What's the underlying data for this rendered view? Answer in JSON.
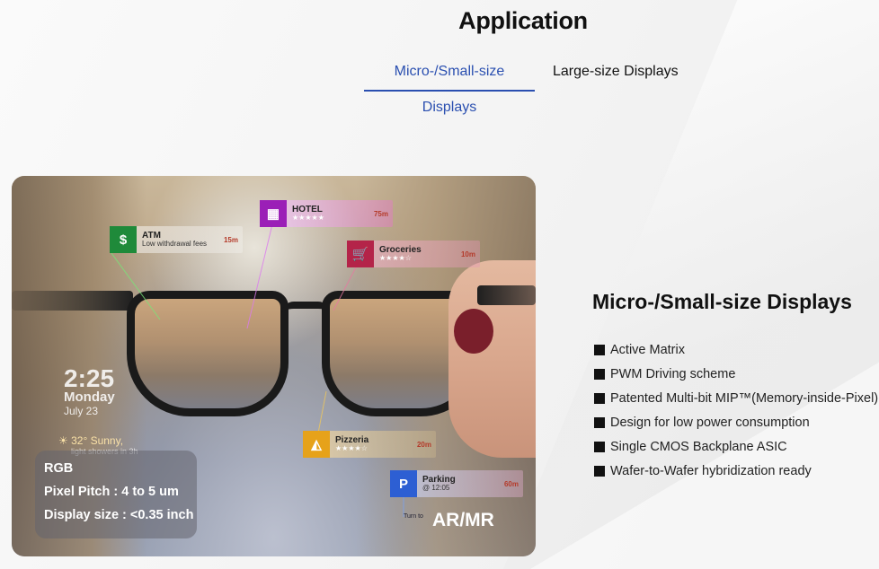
{
  "page": {
    "title": "Application"
  },
  "tabs": [
    {
      "label": "Micro-/Small-size Displays",
      "active": true
    },
    {
      "label": "Large-size Displays",
      "active": false
    }
  ],
  "colors": {
    "accent": "#2a4fb0",
    "atm": "#1f8a3a",
    "hotel": "#9b1fb7",
    "groceries": "#b42449",
    "pizzeria": "#e6a21a",
    "parking": "#2d5fd3"
  },
  "image": {
    "tags": {
      "atm": {
        "icon": "dollar-icon",
        "name": "ATM",
        "sub": "Low withdrawal fees",
        "dist": "15m"
      },
      "hotel": {
        "icon": "building-icon",
        "name": "HOTEL",
        "stars": "★★★★★",
        "dist": "75m"
      },
      "groceries": {
        "icon": "cart-icon",
        "name": "Groceries",
        "stars": "★★★★☆",
        "dist": "10m"
      },
      "pizzeria": {
        "icon": "pizza-icon",
        "name": "Pizzeria",
        "stars": "★★★★☆",
        "dist": "20m"
      },
      "parking": {
        "icon": "parking-icon",
        "name": "Parking",
        "sub": "@ 12:05",
        "dist": "60m"
      }
    },
    "clock": {
      "time": "2:25",
      "day": "Monday",
      "date": "July 23"
    },
    "weather": {
      "text": "☀ 32° Sunny,",
      "sub": "light showers in 3h"
    },
    "turn": "Turn to",
    "specs": [
      "RGB",
      "Pixel Pitch : 4 to 5 um",
      "Display size : <0.35 inch"
    ],
    "label": "AR/MR"
  },
  "detail": {
    "title": "Micro-/Small-size Displays",
    "features": [
      "Active Matrix",
      "PWM Driving scheme",
      "Patented Multi-bit MIP™(Memory-inside-Pixel)",
      "Design for low power consumption",
      "Single CMOS Backplane ASIC",
      "Wafer-to-Wafer hybridization ready"
    ]
  }
}
